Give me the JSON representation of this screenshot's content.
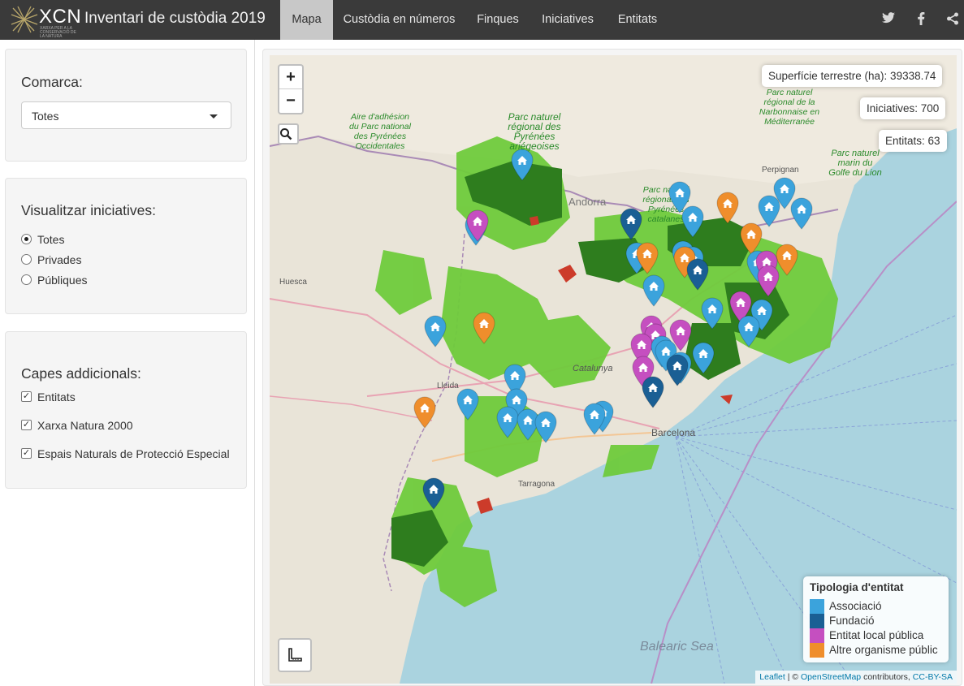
{
  "navbar": {
    "logo_text": "XCN",
    "logo_tagline": "XARXA PER A LA CONSERVACIÓ DE LA NATURA",
    "title": "Inventari de custòdia 2019",
    "tabs": [
      {
        "label": "Mapa",
        "active": true
      },
      {
        "label": "Custòdia en números",
        "active": false
      },
      {
        "label": "Finques",
        "active": false
      },
      {
        "label": "Iniciatives",
        "active": false
      },
      {
        "label": "Entitats",
        "active": false
      }
    ],
    "social_icons": [
      "twitter-icon",
      "facebook-icon",
      "share-icon"
    ]
  },
  "sidebar": {
    "comarca": {
      "label": "Comarca:",
      "selected": "Totes"
    },
    "visualitzar": {
      "label": "Visualitzar iniciatives:",
      "options": [
        {
          "label": "Totes",
          "checked": true
        },
        {
          "label": "Privades",
          "checked": false
        },
        {
          "label": "Públiques",
          "checked": false
        }
      ]
    },
    "capes": {
      "label": "Capes addicionals:",
      "options": [
        {
          "label": "Entitats",
          "checked": true
        },
        {
          "label": "Xarxa Natura 2000",
          "checked": true
        },
        {
          "label": "Espais Naturals de Protecció Especial",
          "checked": true
        }
      ]
    }
  },
  "map": {
    "zoom_in": "+",
    "zoom_out": "−",
    "info": {
      "superficie": "Superfície terrestre (ha): 39338.74",
      "iniciatives": "Iniciatives: 700",
      "entitats": "Entitats: 63"
    },
    "legend": {
      "title": "Tipologia d'entitat",
      "items": [
        {
          "label": "Associació",
          "color": "#3ba3dc"
        },
        {
          "label": "Fundació",
          "color": "#1a5f94"
        },
        {
          "label": "Entitat local pública",
          "color": "#c54fc0"
        },
        {
          "label": "Altre organisme públic",
          "color": "#ef8e2c"
        }
      ]
    },
    "attribution": {
      "leaflet": "Leaflet",
      "sep": " | © ",
      "osm": "OpenStreetMap",
      "contrib": " contributors, ",
      "license": "CC-BY-SA"
    },
    "labels": {
      "andorra": "Andorra",
      "huesca": "Huesca",
      "lleida": "Lleida",
      "catalunya": "Catalunya",
      "tarragona": "Tarragona",
      "barcelona": "Barcelona",
      "perpignan": "Perpignan",
      "balearic": "Balearic Sea",
      "park1": "Aire d'adhésion du Parc national des Pyrénées Occidentales",
      "park2": "Parc naturel régional des Pyrénées ariégeoises",
      "park3": "Parc naturel régional des Pyrénées catalanes",
      "park4": "Parc naturel marin du Golfe du Lion",
      "park5": "Parc naturel régional de la Narbonnaise en Méditerranée"
    },
    "markers": [
      {
        "type": "Associació"
      },
      {
        "type": "Associació"
      },
      {
        "type": "Entitat local pública"
      },
      {
        "type": "Fundació"
      },
      {
        "type": "Associació"
      },
      {
        "type": "Associació"
      },
      {
        "type": "Altre organisme públic"
      },
      {
        "type": "Associació"
      },
      {
        "type": "Associació"
      },
      {
        "type": "Associació"
      },
      {
        "type": "Altre organisme públic"
      },
      {
        "type": "Associació"
      },
      {
        "type": "Altre organisme públic"
      },
      {
        "type": "Associació"
      },
      {
        "type": "Altre organisme públic"
      },
      {
        "type": "Associació"
      },
      {
        "type": "Entitat local pública"
      },
      {
        "type": "Associació"
      },
      {
        "type": "Altre organisme públic"
      },
      {
        "type": "Fundació"
      },
      {
        "type": "Entitat local pública"
      },
      {
        "type": "Associació"
      },
      {
        "type": "Entitat local pública"
      },
      {
        "type": "Associació"
      },
      {
        "type": "Associació"
      },
      {
        "type": "Altre organisme públic"
      },
      {
        "type": "Associació"
      },
      {
        "type": "Entitat local pública"
      },
      {
        "type": "Entitat local pública"
      },
      {
        "type": "Entitat local pública"
      },
      {
        "type": "Entitat local pública"
      },
      {
        "type": "Associació"
      },
      {
        "type": "Associació"
      },
      {
        "type": "Entitat local pública"
      },
      {
        "type": "Associació"
      },
      {
        "type": "Fundació"
      },
      {
        "type": "Fundació"
      },
      {
        "type": "Associació"
      },
      {
        "type": "Associació"
      },
      {
        "type": "Altre organisme públic"
      },
      {
        "type": "Associació"
      },
      {
        "type": "Associació"
      },
      {
        "type": "Associació"
      },
      {
        "type": "Associació"
      },
      {
        "type": "Associació"
      },
      {
        "type": "Associació"
      },
      {
        "type": "Associació"
      },
      {
        "type": "Fundació"
      },
      {
        "type": "Associació"
      }
    ]
  }
}
